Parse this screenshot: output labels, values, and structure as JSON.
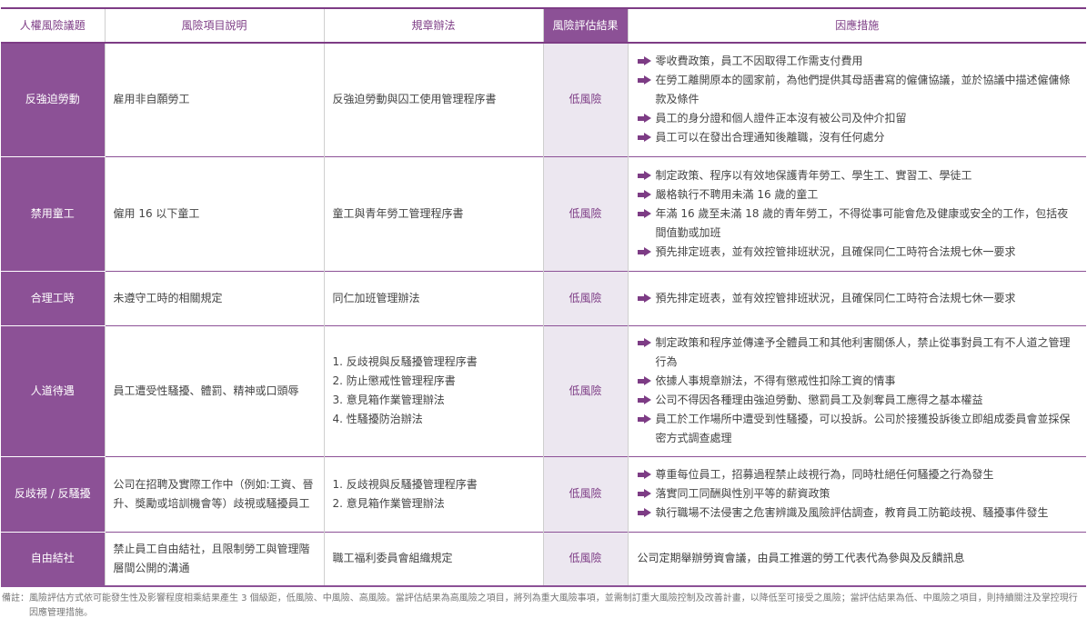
{
  "colors": {
    "accent": "#8c5196",
    "accent_text": "#7d3c85",
    "result_bg": "#ece7f0"
  },
  "headers": {
    "topic": "人權風險議題",
    "desc": "風險項目說明",
    "rules": "規章辦法",
    "result": "風險評估結果",
    "measures": "因應措施"
  },
  "rows": [
    {
      "topic": "反強迫勞動",
      "desc": "雇用非自願勞工",
      "rules": [
        "反強迫勞動與囚工使用管理程序書"
      ],
      "result": "低風險",
      "measures": [
        "零收費政策，員工不因取得工作需支付費用",
        "在勞工離開原本的國家前，為他們提供其母語書寫的僱傭協議，並於協議中描述僱傭條款及條件",
        "員工的身分證和個人證件正本沒有被公司及仲介扣留",
        "員工可以在發出合理通知後離職，沒有任何處分"
      ]
    },
    {
      "topic": "禁用童工",
      "desc": "僱用 16  以下童工",
      "rules": [
        "童工與青年勞工管理程序書"
      ],
      "result": "低風險",
      "measures": [
        "制定政策、程序以有效地保護青年勞工、學生工、實習工、學徒工",
        "嚴格執行不聘用未滿 16 歲的童工",
        "年滿 16 歲至未滿 18 歲的青年勞工，不得從事可能會危及健康或安全的工作，包括夜間值勤或加班",
        "預先排定班表，並有效控管排班狀況，且確保同仁工時符合法規七休一要求"
      ]
    },
    {
      "topic": "合理工時",
      "desc": "未遵守工時的相關規定",
      "rules": [
        "同仁加班管理辦法"
      ],
      "result": "低風險",
      "measures": [
        "預先排定班表，並有效控管排班狀況，且確保同仁工時符合法規七休一要求"
      ]
    },
    {
      "topic": "人道待遇",
      "desc": "員工遭受性騷擾、體罰、精神或口頭辱",
      "rules": [
        "1. 反歧視與反騷擾管理程序書",
        "2. 防止懲戒性管理程序書",
        "3. 意見箱作業管理辦法",
        "4. 性騷擾防治辦法"
      ],
      "result": "低風險",
      "measures": [
        "制定政策和程序並傳達予全體員工和其他利害關係人，禁止從事對員工有不人道之管理行為",
        "依據人事規章辦法，不得有懲戒性扣除工資的情事",
        "公司不得因各種理由強迫勞動、懲罰員工及剝奪員工應得之基本權益",
        "員工於工作場所中遭受到性騷擾，可以投訴。公司於接獲投訴後立即組成委員會並採保密方式調查處理"
      ]
    },
    {
      "topic": "反歧視 / 反騷擾",
      "desc": "公司在招聘及實際工作中（例如:工資、晉升、獎勵或培訓機會等）歧視或騷擾員工",
      "rules": [
        "1. 反歧視與反騷擾管理程序書",
        "2. 意見箱作業管理辦法"
      ],
      "result": "低風險",
      "measures": [
        "尊重每位員工，招募過程禁止歧視行為，同時杜絕任何騷擾之行為發生",
        "落實同工同酬與性別平等的薪資政策",
        "執行職場不法侵害之危害辨識及風險評估調查，教育員工防範歧視、騷擾事件發生"
      ]
    },
    {
      "topic": "自由結社",
      "desc": "禁止員工自由結社，且限制勞工與管理階層間公開的溝通",
      "rules": [
        "職工福利委員會組織規定"
      ],
      "result": "低風險",
      "measures_plain": "公司定期舉辦勞資會議，由員工推選的勞工代表代為參與及反饋訊息"
    }
  ],
  "footnote": "備註：風險評估方式依可能發生性及影響程度相乘結果產生 3 個級距，低風險、中風險、高風險。當評估結果為高風險之項目，將列為重大風險事項，並需制訂重大風險控制及改善計畫，以降低至可接受之風險；當評估結果為低、中風險之項目，則持續關注及掌控現行因應管理措施。"
}
